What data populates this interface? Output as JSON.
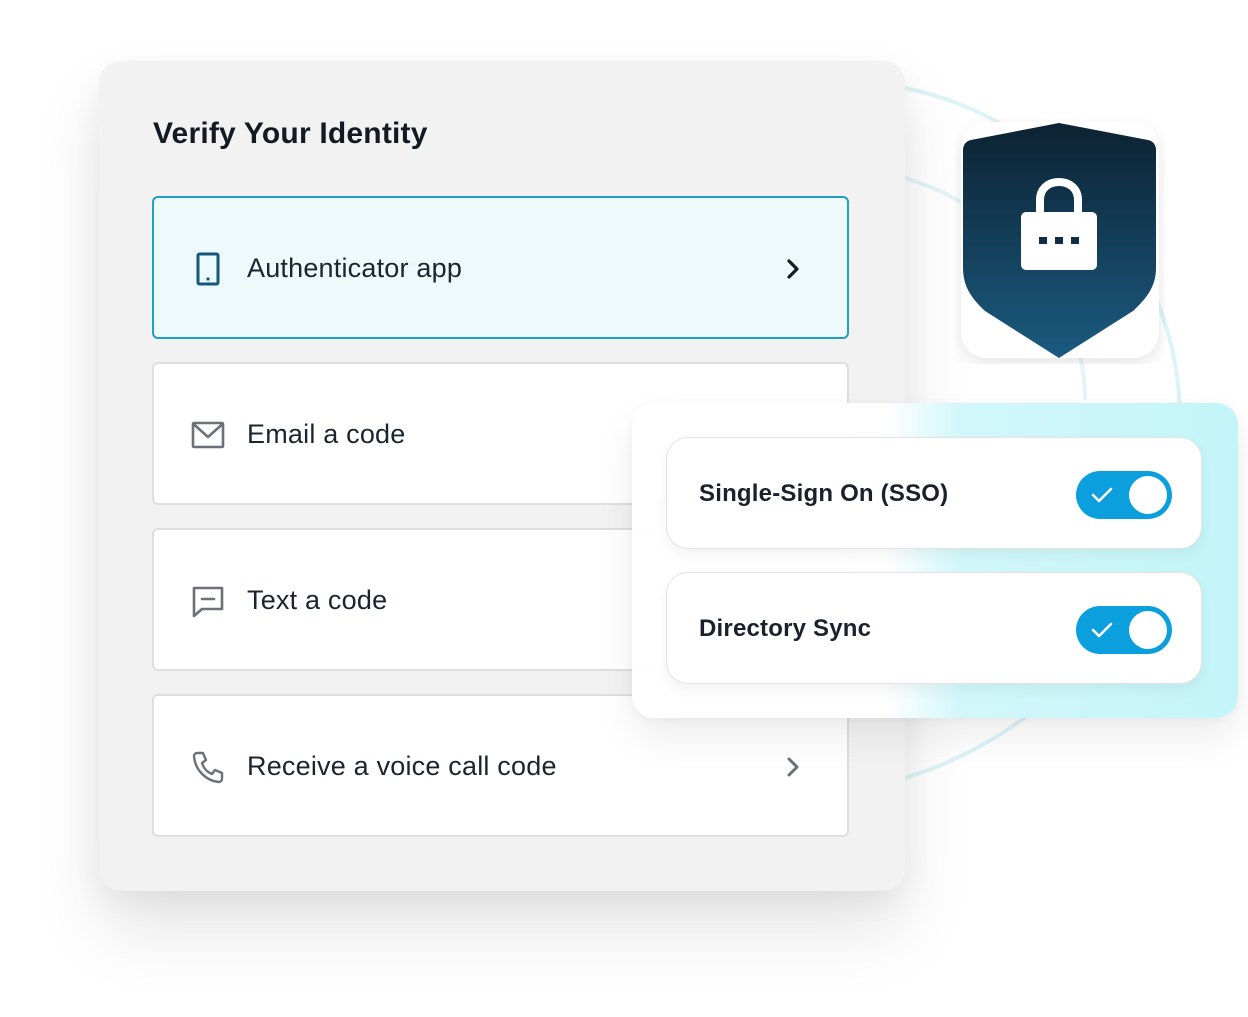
{
  "verify": {
    "title": "Verify Your Identity",
    "options": [
      {
        "label": "Authenticator app",
        "icon": "phone-icon",
        "selected": true
      },
      {
        "label": "Email a code",
        "icon": "envelope-icon",
        "selected": false
      },
      {
        "label": "Text a code",
        "icon": "message-icon",
        "selected": false
      },
      {
        "label": "Receive a voice call code",
        "icon": "phone-call-icon",
        "selected": false
      }
    ]
  },
  "security_badge": {
    "icon": "lock-shield-icon"
  },
  "toggles": [
    {
      "label": "Single-Sign On (SSO)",
      "enabled": true
    },
    {
      "label": "Directory Sync",
      "enabled": true
    }
  ],
  "colors": {
    "accent": "#0ba0dd",
    "selected_border": "#1f9fc9",
    "selected_bg": "#eef9fc",
    "shield_top": "#0c2232",
    "shield_bottom": "#1b5a80",
    "panel_glow": "#c3f5f8"
  }
}
